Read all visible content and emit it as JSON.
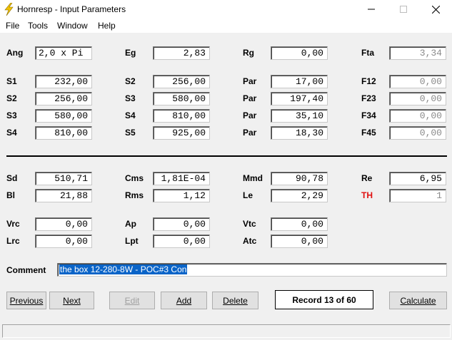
{
  "window": {
    "title": "Hornresp - Input Parameters",
    "accent_icon_color": "#f2c200"
  },
  "menu": [
    "File",
    "Tools",
    "Window",
    "Help"
  ],
  "top_section": [
    {
      "label": "Ang",
      "value": "2,0 x Pi"
    },
    {
      "label": "Eg",
      "value": "2,83"
    },
    {
      "label": "Rg",
      "value": "0,00"
    },
    {
      "label": "Fta",
      "value": "3,34"
    },
    {
      "label": "S1",
      "value": "232,00"
    },
    {
      "label": "S2",
      "value": "256,00"
    },
    {
      "label": "Par",
      "value": "17,00"
    },
    {
      "label": "F12",
      "value": "0,00"
    },
    {
      "label": "S2",
      "value": "256,00"
    },
    {
      "label": "S3",
      "value": "580,00"
    },
    {
      "label": "Par",
      "value": "197,40"
    },
    {
      "label": "F23",
      "value": "0,00"
    },
    {
      "label": "S3",
      "value": "580,00"
    },
    {
      "label": "S4",
      "value": "810,00"
    },
    {
      "label": "Par",
      "value": "35,10"
    },
    {
      "label": "F34",
      "value": "0,00"
    },
    {
      "label": "S4",
      "value": "810,00"
    },
    {
      "label": "S5",
      "value": "925,00"
    },
    {
      "label": "Par",
      "value": "18,30"
    },
    {
      "label": "F45",
      "value": "0,00"
    }
  ],
  "driver_section": [
    {
      "label": "Sd",
      "value": "510,71"
    },
    {
      "label": "Cms",
      "value": "1,81E-04"
    },
    {
      "label": "Mmd",
      "value": "90,78"
    },
    {
      "label": "Re",
      "value": "6,95"
    },
    {
      "label": "Bl",
      "value": "21,88"
    },
    {
      "label": "Rms",
      "value": "1,12"
    },
    {
      "label": "Le",
      "value": "2,29"
    },
    {
      "label": "TH",
      "value": "1"
    }
  ],
  "chamber_section": [
    {
      "label": "Vrc",
      "value": "0,00"
    },
    {
      "label": "Ap",
      "value": "0,00"
    },
    {
      "label": "Vtc",
      "value": "0,00"
    },
    {
      "label": "Lrc",
      "value": "0,00"
    },
    {
      "label": "Lpt",
      "value": "0,00"
    },
    {
      "label": "Atc",
      "value": "0,00"
    }
  ],
  "comment": {
    "label": "Comment",
    "value": "the box 12-280-8W - POC#3 Con"
  },
  "buttons": {
    "previous": "Previous",
    "next": "Next",
    "edit": "Edit",
    "add": "Add",
    "delete": "Delete",
    "calculate": "Calculate"
  },
  "record": "Record 13 of 60",
  "colors": {
    "th_label": "#e01010",
    "selection": "#0a64c8"
  }
}
